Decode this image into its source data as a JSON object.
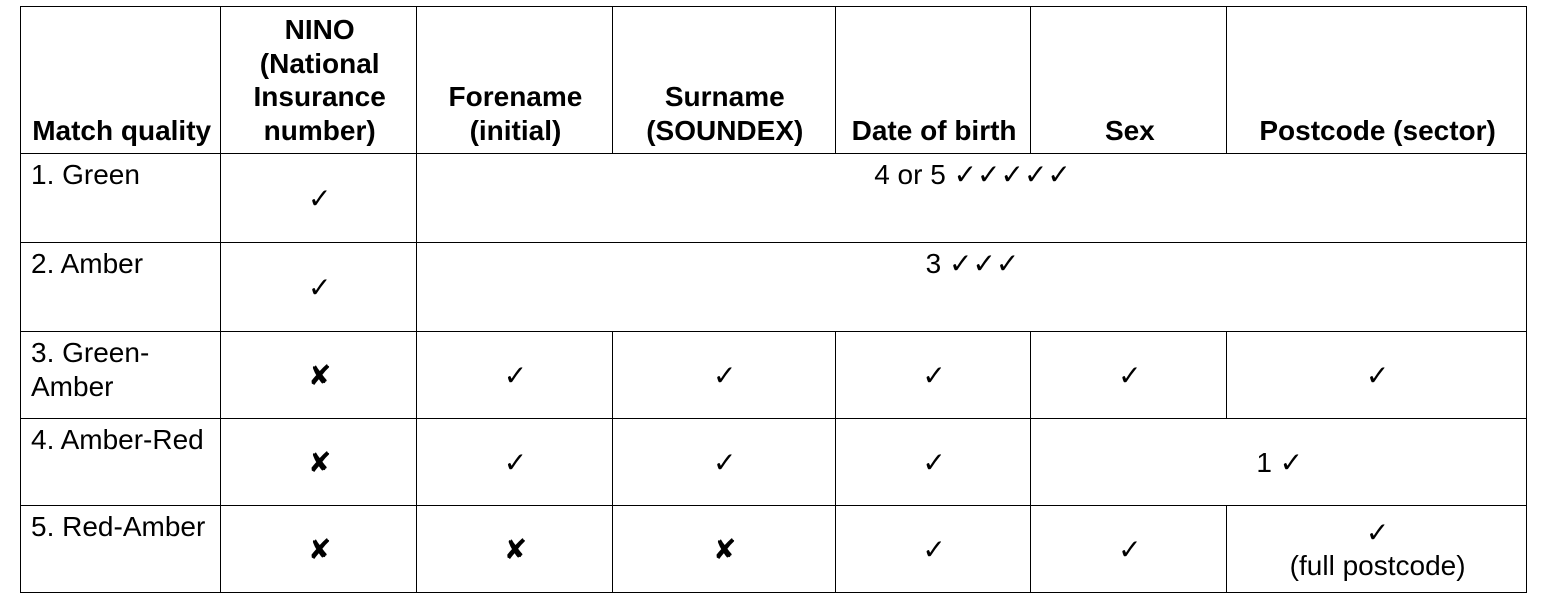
{
  "symbols": {
    "check": "✓",
    "cross": "✘"
  },
  "headers": {
    "match_quality": "Match quality",
    "nino": "NINO (National Insurance number)",
    "forename": "Forename (initial)",
    "surname": "Surname (SOUNDEX)",
    "dob": "Date of birth",
    "sex": "Sex",
    "postcode": "Postcode (sector)"
  },
  "rows": {
    "r1": {
      "label": "1. Green",
      "nino": "✓",
      "group": "4 or 5 ✓✓✓✓✓"
    },
    "r2": {
      "label": "2. Amber",
      "nino": "✓",
      "group": "3 ✓✓✓"
    },
    "r3": {
      "label": "3. Green-Amber",
      "nino": "✘",
      "forename": "✓",
      "surname": "✓",
      "dob": "✓",
      "sex": "✓",
      "postcode": "✓"
    },
    "r4": {
      "label": "4. Amber-Red",
      "nino": "✘",
      "forename": "✓",
      "surname": "✓",
      "dob": "✓",
      "group": "1 ✓"
    },
    "r5": {
      "label": "5. Red-Amber",
      "nino": "✘",
      "forename": "✘",
      "surname": "✘",
      "dob": "✓",
      "sex": "✓",
      "postcode_main": "✓",
      "postcode_sub": "(full postcode)"
    }
  }
}
